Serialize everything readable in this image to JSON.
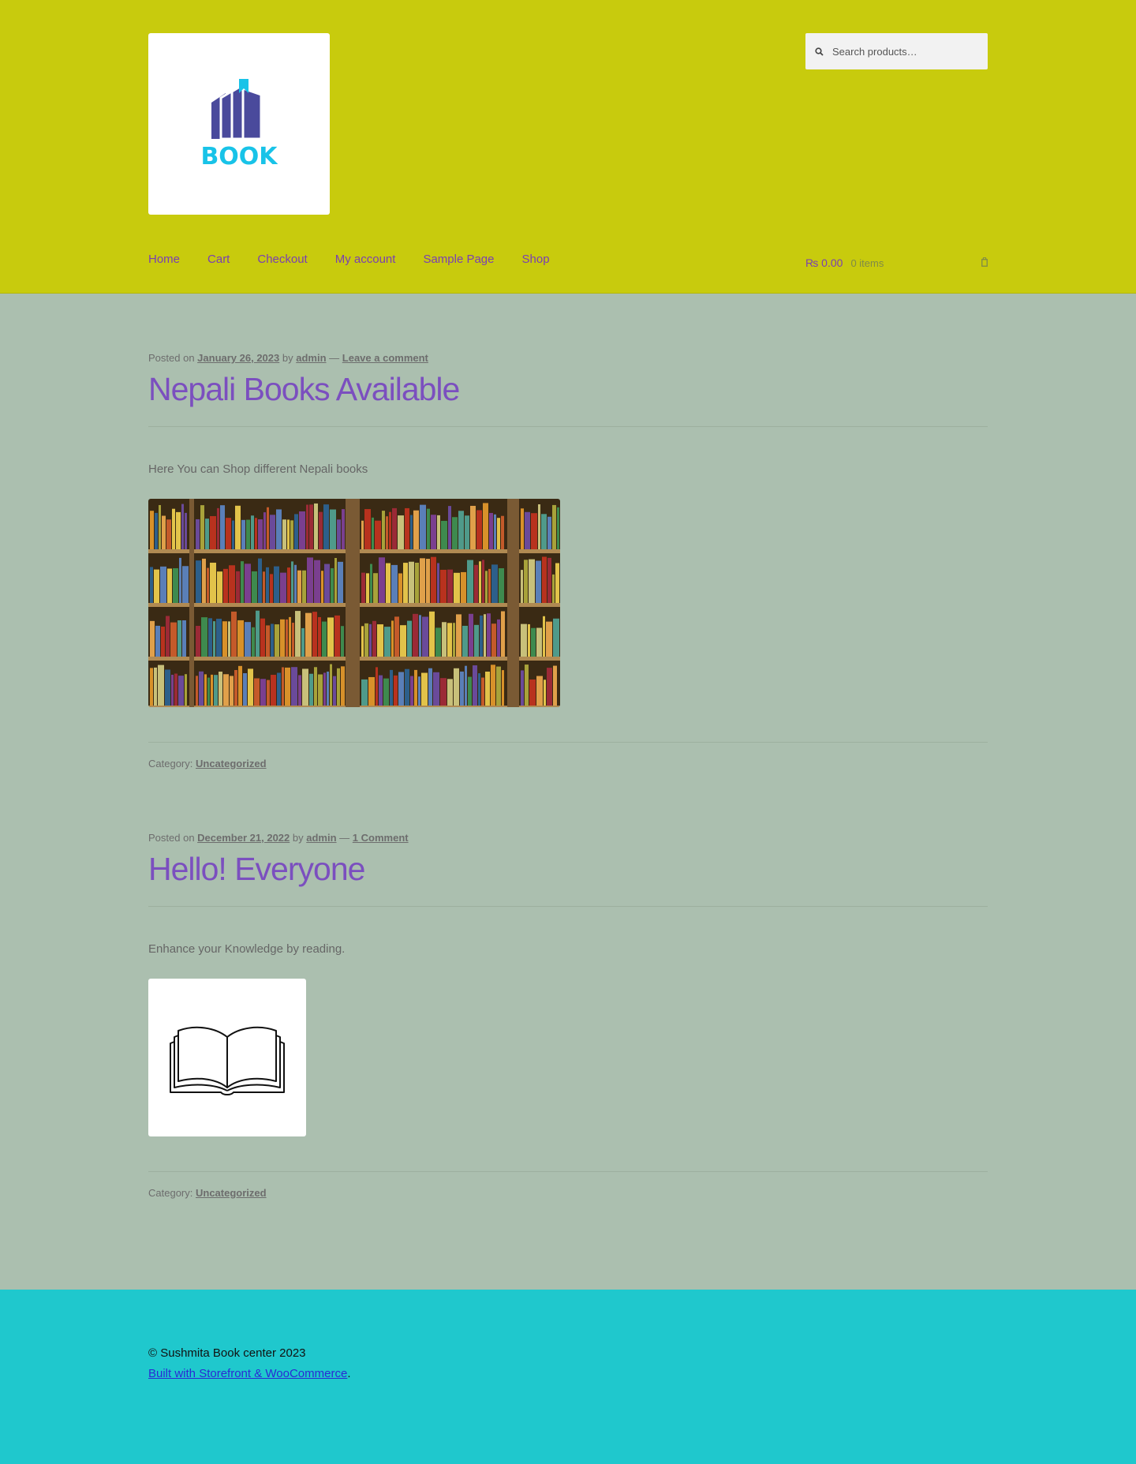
{
  "header": {
    "logo_text": "BOOK",
    "search": {
      "placeholder": "Search products…"
    },
    "nav": [
      {
        "label": "Home"
      },
      {
        "label": "Cart"
      },
      {
        "label": "Checkout"
      },
      {
        "label": "My account"
      },
      {
        "label": "Sample Page"
      },
      {
        "label": "Shop"
      }
    ],
    "cart": {
      "amount": "₨ 0.00",
      "count": "0 items"
    }
  },
  "posts": [
    {
      "posted_on": "Posted on",
      "date": "January 26, 2023",
      "by": "by",
      "author": "admin",
      "dash": "—",
      "comments": "Leave a comment",
      "title": "Nepali Books Available",
      "body": "Here You can Shop different Nepali books",
      "image": "bookshelf-painting",
      "category_label": "Category:",
      "category": "Uncategorized"
    },
    {
      "posted_on": "Posted on",
      "date": "December 21, 2022",
      "by": "by",
      "author": "admin",
      "dash": "—",
      "comments": "1 Comment",
      "title": "Hello! Everyone",
      "body": "Enhance your Knowledge by reading.",
      "image": "open-book-icon",
      "category_label": "Category:",
      "category": "Uncategorized"
    }
  ],
  "footer": {
    "copyright": "© Sushmita Book center 2023",
    "built_link": "Built with Storefront & WooCommerce",
    "built_suffix": "."
  },
  "colors": {
    "header_bg": "#c8cb0d",
    "page_bg": "#abbfaf",
    "footer_bg": "#1fc8cd",
    "link_purple": "#7a3fb2"
  }
}
